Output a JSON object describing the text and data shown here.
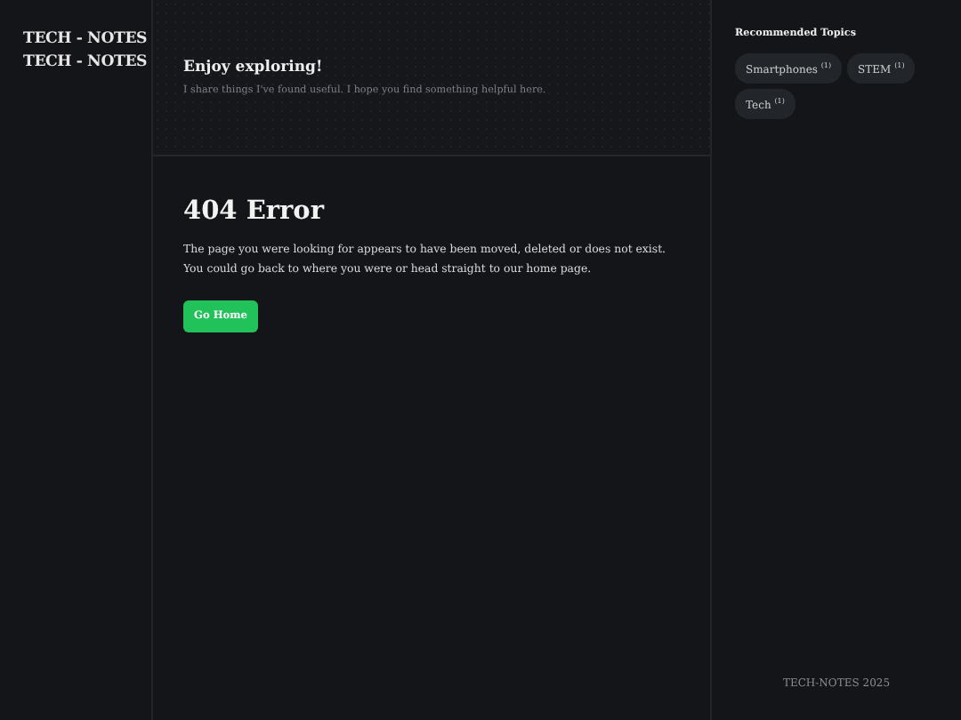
{
  "sidebar": {
    "brand_lines": [
      "TECH - NOTES",
      "TECH - NOTES"
    ]
  },
  "header": {
    "title": "Enjoy exploring!",
    "subtitle": "I share things I've found useful. I hope you find something helpful here."
  },
  "error": {
    "title": "404 Error",
    "message": "The page you were looking for appears to have been moved, deleted or does not exist. You could go back to where you were or head straight to our home page.",
    "button": "Go Home"
  },
  "topics": {
    "heading": "Recommended Topics",
    "tags": [
      {
        "label": "Smartphones",
        "count": "(1)"
      },
      {
        "label": "STEM",
        "count": "(1)"
      },
      {
        "label": "Tech",
        "count": "(1)"
      }
    ]
  },
  "footer": "TECH-NOTES 2025"
}
